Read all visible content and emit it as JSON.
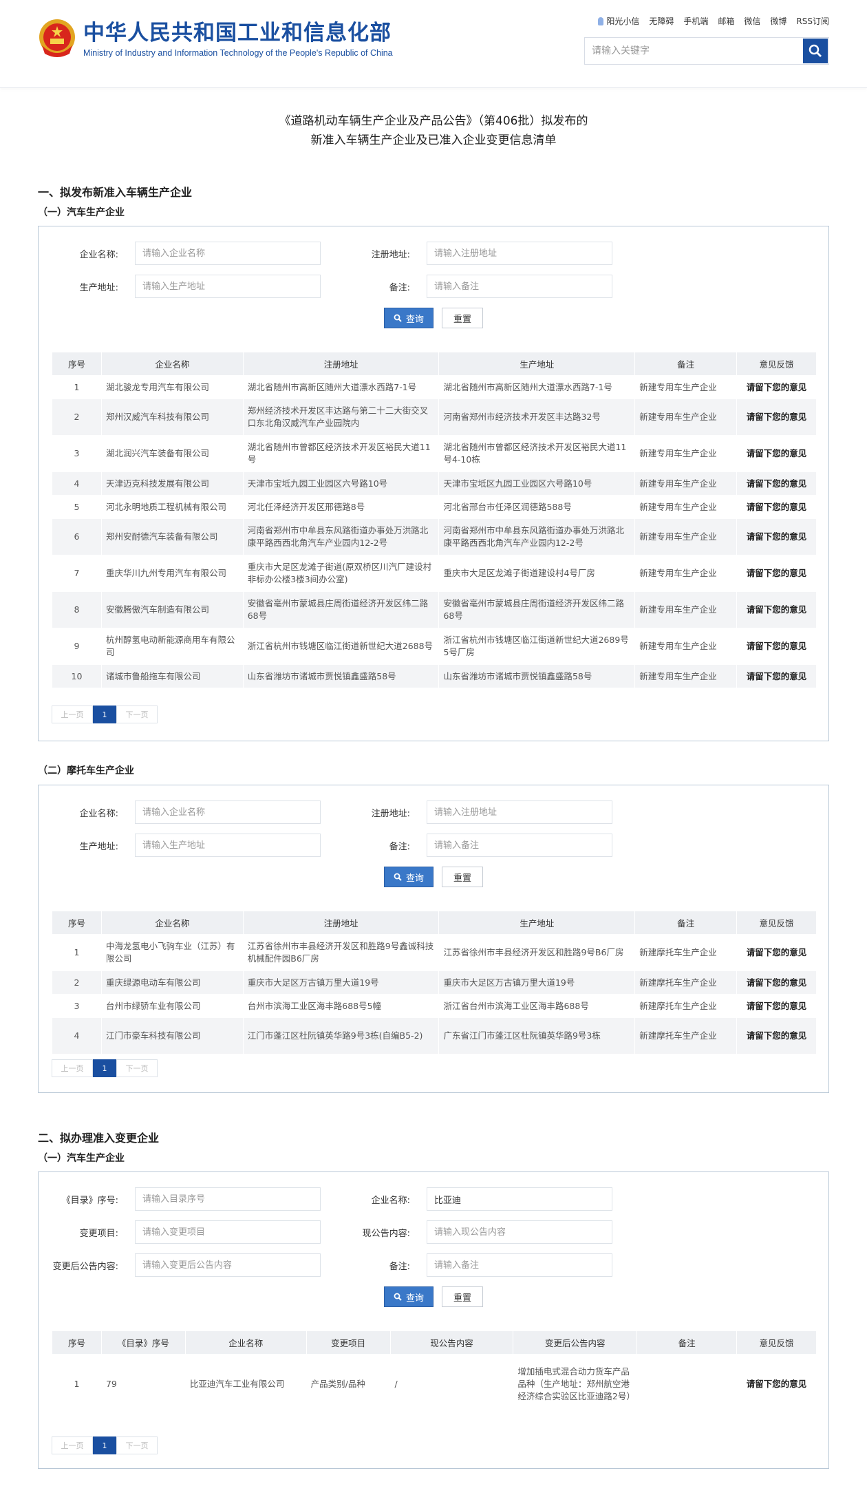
{
  "header": {
    "title_cn": "中华人民共和国工业和信息化部",
    "title_en": "Ministry of Industry and Information Technology of the People's Republic of China",
    "links": [
      "阳光小信",
      "无障碍",
      "手机端",
      "邮箱",
      "微信",
      "微博",
      "RSS订阅"
    ],
    "search_placeholder": "请输入关键字"
  },
  "page_title": [
    "《道路机动车辆生产企业及产品公告》（第406批）拟发布的",
    "新准入车辆生产企业及已准入企业变更信息清单"
  ],
  "labels": {
    "query": "查询",
    "reset": "重置",
    "prev": "上一页",
    "next": "下一页",
    "page": "1",
    "feedback": "请留下您的意见"
  },
  "section1": {
    "title": "一、拟发布新准入车辆生产企业",
    "auto": {
      "title": "（一）汽车生产企业",
      "form": {
        "name_label": "企业名称:",
        "name_ph": "请输入企业名称",
        "reg_label": "注册地址:",
        "reg_ph": "请输入注册地址",
        "prod_label": "生产地址:",
        "prod_ph": "请输入生产地址",
        "note_label": "备注:",
        "note_ph": "请输入备注"
      },
      "headers": [
        "序号",
        "企业名称",
        "注册地址",
        "生产地址",
        "备注",
        "意见反馈"
      ],
      "rows": [
        [
          "1",
          "湖北骏龙专用汽车有限公司",
          "湖北省随州市高新区随州大道漂水西路7-1号",
          "湖北省随州市高新区随州大道漂水西路7-1号",
          "新建专用车生产企业"
        ],
        [
          "2",
          "郑州汉威汽车科技有限公司",
          "郑州经济技术开发区丰达路与第二十二大街交叉口东北角汉威汽车产业园院内",
          "河南省郑州市经济技术开发区丰达路32号",
          "新建专用车生产企业"
        ],
        [
          "3",
          "湖北润兴汽车装备有限公司",
          "湖北省随州市曾都区经济技术开发区裕民大道11号",
          "湖北省随州市曾都区经济技术开发区裕民大道11号4-10栋",
          "新建专用车生产企业"
        ],
        [
          "4",
          "天津迈克科技发展有限公司",
          "天津市宝坻九园工业园区六号路10号",
          "天津市宝坻区九园工业园区六号路10号",
          "新建专用车生产企业"
        ],
        [
          "5",
          "河北永明地质工程机械有限公司",
          "河北任泽经济开发区邢德路8号",
          "河北省邢台市任泽区润德路588号",
          "新建专用车生产企业"
        ],
        [
          "6",
          "郑州安耐德汽车装备有限公司",
          "河南省郑州市中牟县东风路街道办事处万洪路北康平路西西北角汽车产业园内12-2号",
          "河南省郑州市中牟县东风路街道办事处万洪路北康平路西西北角汽车产业园内12-2号",
          "新建专用车生产企业"
        ],
        [
          "7",
          "重庆华川九州专用汽车有限公司",
          "重庆市大足区龙滩子街道(原双桥区川汽厂建设村非标办公楼3楼3间办公室)",
          "重庆市大足区龙滩子街道建设村4号厂房",
          "新建专用车生产企业"
        ],
        [
          "8",
          "安徽腾傲汽车制造有限公司",
          "安徽省亳州市蒙城县庄周街道经济开发区纬二路68号",
          "安徽省亳州市蒙城县庄周街道经济开发区纬二路68号",
          "新建专用车生产企业"
        ],
        [
          "9",
          "杭州醇氢电动新能源商用车有限公司",
          "浙江省杭州市钱塘区临江街道新世纪大道2688号",
          "浙江省杭州市钱塘区临江街道新世纪大道2689号5号厂房",
          "新建专用车生产企业"
        ],
        [
          "10",
          "诸城市鲁船拖车有限公司",
          "山东省潍坊市诸城市贾悦镇鑫盛路58号",
          "山东省潍坊市诸城市贾悦镇鑫盛路58号",
          "新建专用车生产企业"
        ]
      ]
    },
    "moto": {
      "title": "（二）摩托车生产企业",
      "rows": [
        [
          "1",
          "中海龙氢电小飞驹车业（江苏）有限公司",
          "江苏省徐州市丰县经济开发区和胜路9号鑫诚科技机械配件园B6厂房",
          "江苏省徐州市丰县经济开发区和胜路9号B6厂房",
          "新建摩托车生产企业"
        ],
        [
          "2",
          "重庆绿源电动车有限公司",
          "重庆市大足区万古镇万里大道19号",
          "重庆市大足区万古镇万里大道19号",
          "新建摩托车生产企业"
        ],
        [
          "3",
          "台州市绿骄车业有限公司",
          "台州市滨海工业区海丰路688号5幢",
          "浙江省台州市滨海工业区海丰路688号",
          "新建摩托车生产企业"
        ],
        [
          "4",
          "江门市豪车科技有限公司",
          "江门市蓬江区杜阮镇英华路9号3栋(自编B5-2)",
          "广东省江门市蓬江区杜阮镇英华路9号3栋",
          "新建摩托车生产企业"
        ]
      ]
    }
  },
  "section2": {
    "title": "二、拟办理准入变更企业",
    "sub": "（一）汽车生产企业",
    "form": {
      "cat_label": "《目录》序号:",
      "cat_ph": "请输入目录序号",
      "name_label": "企业名称:",
      "name_val": "比亚迪",
      "item_label": "变更项目:",
      "item_ph": "请输入变更项目",
      "cur_label": "现公告内容:",
      "cur_ph": "请输入现公告内容",
      "after_label": "变更后公告内容:",
      "after_ph": "请输入变更后公告内容",
      "note_label": "备注:",
      "note_ph": "请输入备注"
    },
    "headers": [
      "序号",
      "《目录》序号",
      "企业名称",
      "变更项目",
      "现公告内容",
      "变更后公告内容",
      "备注",
      "意见反馈"
    ],
    "rows": [
      [
        "1",
        "79",
        "比亚迪汽车工业有限公司",
        "产品类别/品种",
        "/",
        "增加插电式混合动力货车产品品种（生产地址：郑州航空港经济综合实验区比亚迪路2号）",
        ""
      ]
    ]
  }
}
